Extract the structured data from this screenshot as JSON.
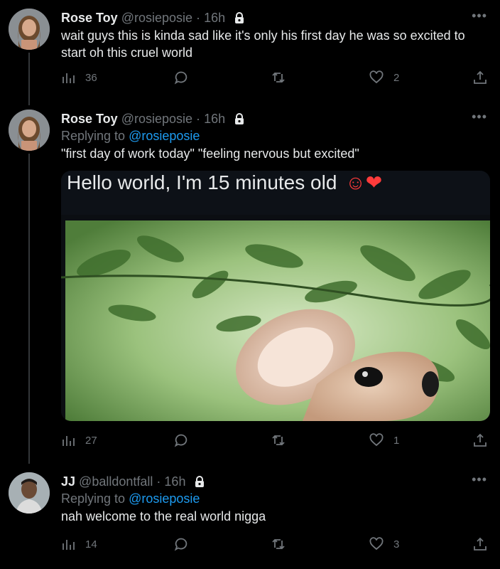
{
  "tweets": [
    {
      "name": "Rose Toy",
      "handle": "@rosieposie",
      "separator": "·",
      "time": "16h",
      "text": "wait guys this is kinda sad like it's only his first day he was so excited to start oh this cruel world",
      "stats": {
        "views": "36",
        "replies": "",
        "retweets": "",
        "likes": "2"
      }
    },
    {
      "name": "Rose Toy",
      "handle": "@rosieposie",
      "separator": "·",
      "time": "16h",
      "replying_prefix": "Replying to",
      "replying_to": "@rosieposie",
      "text": "\"first day of work today\" \"feeling nervous but excited\"",
      "media_caption": "Hello world, I'm 15 minutes old",
      "media_emojis": "☺❤",
      "stats": {
        "views": "27",
        "replies": "",
        "retweets": "",
        "likes": "1"
      }
    },
    {
      "name": "JJ",
      "handle": "@balldontfall",
      "separator": "·",
      "time": "16h",
      "replying_prefix": "Replying to",
      "replying_to": "@rosieposie",
      "text": "nah welcome to the real world nigga",
      "stats": {
        "views": "14",
        "replies": "",
        "retweets": "",
        "likes": "3"
      }
    }
  ],
  "icons": {
    "views": "bar-chart-icon",
    "reply": "reply-icon",
    "retweet": "retweet-icon",
    "like": "heart-icon",
    "share": "share-icon",
    "lock": "lock-icon",
    "more": "more-icon"
  },
  "colors": {
    "background": "#000000",
    "text": "#e7e9ea",
    "muted": "#71767b",
    "link": "#1d9bf0"
  }
}
